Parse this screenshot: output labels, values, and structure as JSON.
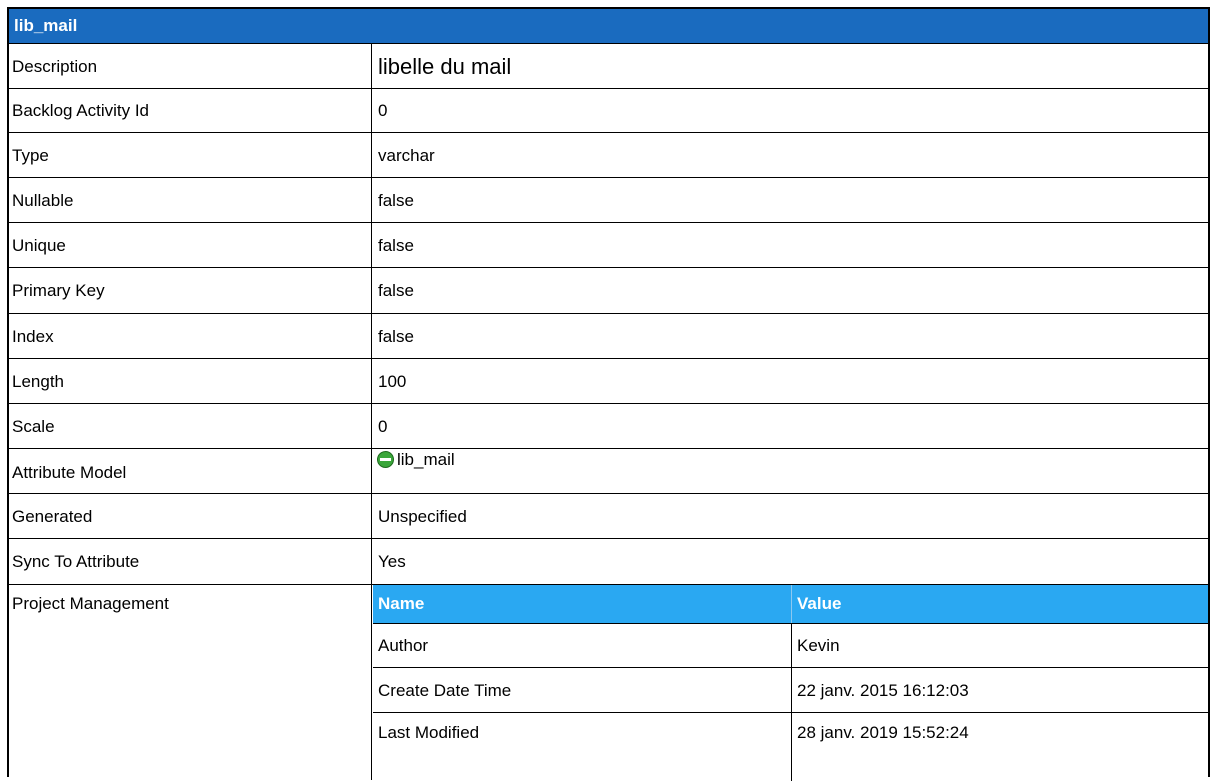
{
  "header": {
    "title": "lib_mail"
  },
  "rows": [
    {
      "label": "Description",
      "value": "libelle du mail"
    },
    {
      "label": "Backlog Activity Id",
      "value": "0"
    },
    {
      "label": "Type",
      "value": "varchar"
    },
    {
      "label": "Nullable",
      "value": "false"
    },
    {
      "label": "Unique",
      "value": "false"
    },
    {
      "label": "Primary Key",
      "value": "false"
    },
    {
      "label": "Index",
      "value": "false"
    },
    {
      "label": "Length",
      "value": "100"
    },
    {
      "label": "Scale",
      "value": "0"
    },
    {
      "label": "Attribute Model",
      "value": "lib_mail",
      "icon": "attribute-icon"
    },
    {
      "label": "Generated",
      "value": "Unspecified"
    },
    {
      "label": "Sync To Attribute",
      "value": "Yes"
    },
    {
      "label": "Project Management"
    }
  ],
  "project_management": {
    "columns": [
      "Name",
      "Value"
    ],
    "rows": [
      [
        "Author",
        "Kevin"
      ],
      [
        "Create Date Time",
        "22 janv. 2015 16:12:03"
      ],
      [
        "Last Modified",
        "28 janv. 2019 15:52:24"
      ]
    ]
  },
  "colors": {
    "header_bg": "#1a6bbf",
    "subheader_bg": "#2aa8f2",
    "icon_green": "#3aa63a"
  }
}
